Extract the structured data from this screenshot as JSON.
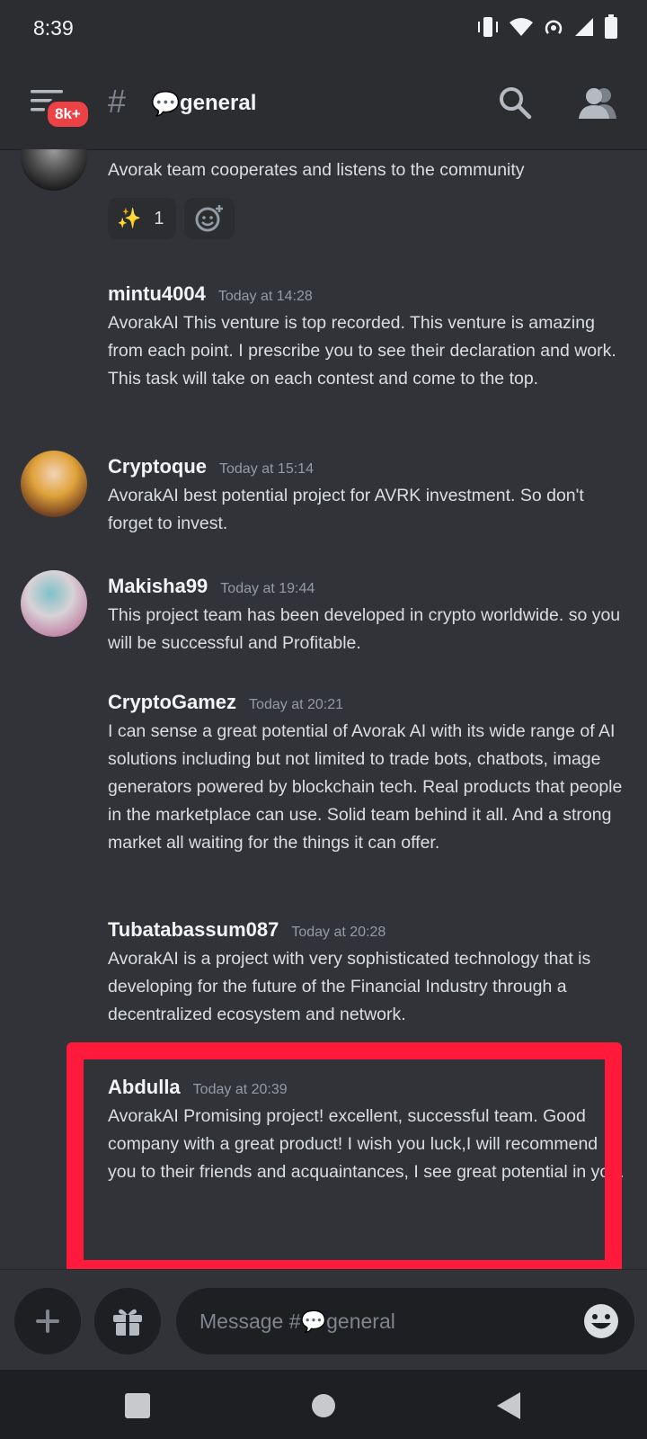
{
  "status_bar": {
    "time": "8:39",
    "icons": [
      "vibrate-icon",
      "wifi-icon",
      "hotspot-icon",
      "signal-icon",
      "battery-icon"
    ]
  },
  "header": {
    "unread_badge": "8k+",
    "channel_emoji": "💬",
    "channel_name": "general"
  },
  "messages": [
    {
      "username": "",
      "timestamp": "",
      "text": "Avorak team cooperates and listens to the community",
      "reaction": {
        "emoji": "✨",
        "count": "1"
      }
    },
    {
      "username": "mintu4004",
      "timestamp": "Today at 14:28",
      "text": "AvorakAI This venture is top recorded. This venture is amazing from each point. I prescribe you to see their declaration and work. This task will take on each contest and come to the top."
    },
    {
      "username": "Cryptoque",
      "timestamp": "Today at 15:14",
      "text": "AvorakAI best potential project for AVRK investment. So don't forget to invest."
    },
    {
      "username": "Makisha99",
      "timestamp": "Today at 19:44",
      "text": "This project team has been developed in crypto worldwide. so you will be successful and Profitable."
    },
    {
      "username": "CryptoGamez",
      "timestamp": "Today at 20:21",
      "text": "I can sense a great potential of Avorak AI with its  wide range of AI solutions including but not limited to trade bots, chatbots, image generators powered by blockchain tech. Real products that people in the marketplace can use. Solid team behind it all. And a strong market all waiting for the things it can offer."
    },
    {
      "username": "Tubatabassum087",
      "timestamp": "Today at 20:28",
      "text": "AvorakAI is a project with very sophisticated technology that is developing for the future of the Financial Industry through a decentralized ecosystem and network."
    },
    {
      "username": "Abdulla",
      "timestamp": "Today at 20:39",
      "text": "AvorakAI Promising project! excellent, successful team. Good company with a great product! I wish you luck,I will recommend you to their friends and acquaintances, I see great potential in you."
    }
  ],
  "composer": {
    "placeholder": "Message #💬general"
  },
  "colors": {
    "background": "#313338",
    "header": "#2b2d31",
    "highlight_box": "#ff1a3c",
    "badge": "#ed4245"
  }
}
